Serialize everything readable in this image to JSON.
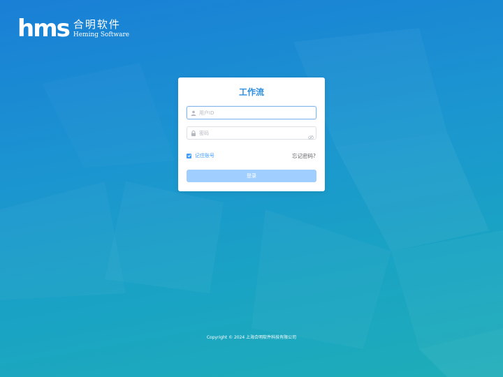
{
  "brand": {
    "mark": "hms",
    "name_cn": "合明软件",
    "name_en": "Heming Software"
  },
  "login": {
    "title": "工作流",
    "username_placeholder": "用户ID",
    "password_placeholder": "密码",
    "remember_label": "记住账号",
    "remember_checked": true,
    "forgot_label": "忘记密码?",
    "submit_label": "登录"
  },
  "footer": {
    "copyright": "Copyright © 2024 上海合明软件科技有限公司"
  },
  "colors": {
    "accent": "#409eff",
    "title": "#2d8de0",
    "button_disabled": "#a0cfff"
  },
  "icons": {
    "username": "user-icon",
    "password": "lock-icon",
    "toggle": "eye-icon",
    "remember": "check-icon"
  }
}
